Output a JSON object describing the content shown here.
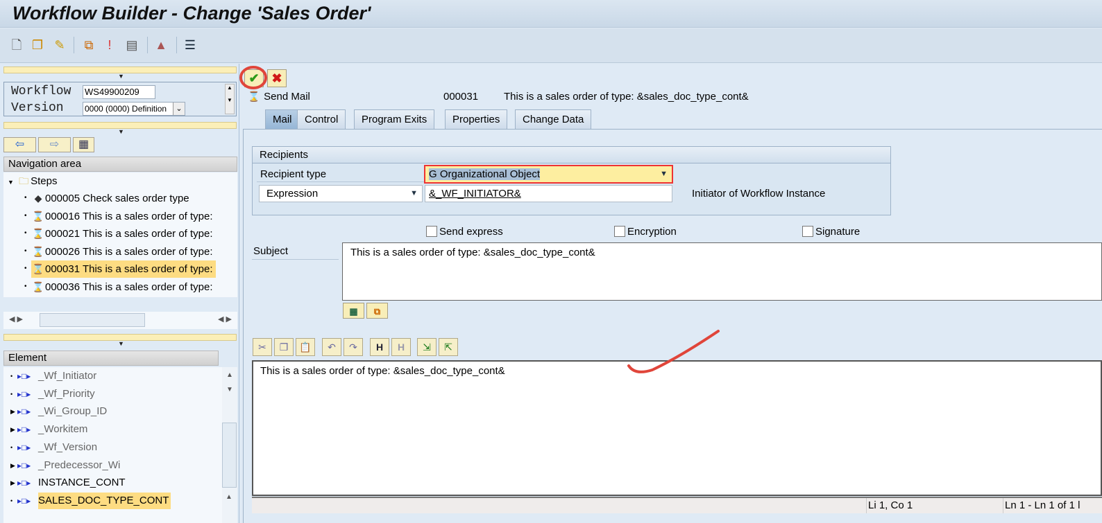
{
  "title": "Workflow Builder - Change 'Sales Order'",
  "header": {
    "workflow_label": "Workflow",
    "workflow_value": "WS49900209",
    "version_label": "Version",
    "version_value": "0000 (0000) Definition"
  },
  "nav": {
    "title": "Navigation area",
    "root": "Steps",
    "steps": [
      {
        "label": "000005 Check sales order type",
        "icon": "condition-icon"
      },
      {
        "label": "000016 This is a sales order of type:",
        "icon": "send-mail-icon"
      },
      {
        "label": "000021 This is a sales order of type:",
        "icon": "send-mail-icon"
      },
      {
        "label": "000026 This is a sales order of type:",
        "icon": "send-mail-icon"
      },
      {
        "label": "000031 This is a sales order of type:",
        "icon": "send-mail-icon",
        "selected": true
      },
      {
        "label": "000036 This is a sales order of type:",
        "icon": "send-mail-icon"
      }
    ]
  },
  "elements": {
    "title": "Element",
    "items": [
      {
        "label": "_Wf_Initiator",
        "system": true
      },
      {
        "label": "_Wf_Priority",
        "system": true
      },
      {
        "label": "_Wi_Group_ID",
        "system": true
      },
      {
        "label": "_Workitem",
        "system": true
      },
      {
        "label": "_Wf_Version",
        "system": true
      },
      {
        "label": "_Predecessor_Wi",
        "system": true
      },
      {
        "label": "INSTANCE_CONT",
        "system": false
      },
      {
        "label": "SALES_DOC_TYPE_CONT",
        "system": false,
        "selected": true
      }
    ]
  },
  "step": {
    "type": "Send Mail",
    "number": "000031",
    "description": "This is a sales order of type: &sales_doc_type_cont&"
  },
  "tabs": [
    "Mail",
    "Control",
    "Program Exits",
    "Properties",
    "Change Data"
  ],
  "recipients": {
    "title": "Recipients",
    "type_label": "Recipient type",
    "type_value": "G Organizational Object",
    "expr_select": "Expression",
    "expr_value": "&_WF_INITIATOR&",
    "expr_desc": "Initiator of Workflow Instance"
  },
  "options": {
    "send_express": "Send express",
    "encryption": "Encryption",
    "signature": "Signature"
  },
  "subject": {
    "label": "Subject",
    "value": "This is a sales order of type: &sales_doc_type_cont&"
  },
  "body": {
    "value": "This is a sales order of type: &sales_doc_type_cont&"
  },
  "status": {
    "cursor": "Li 1, Co 1",
    "lines": "Ln 1 - Ln 1 of 1 l"
  },
  "colors": {
    "selection": "#fddc82",
    "panel": "#dfeaf5",
    "annotation": "#e0453a"
  }
}
